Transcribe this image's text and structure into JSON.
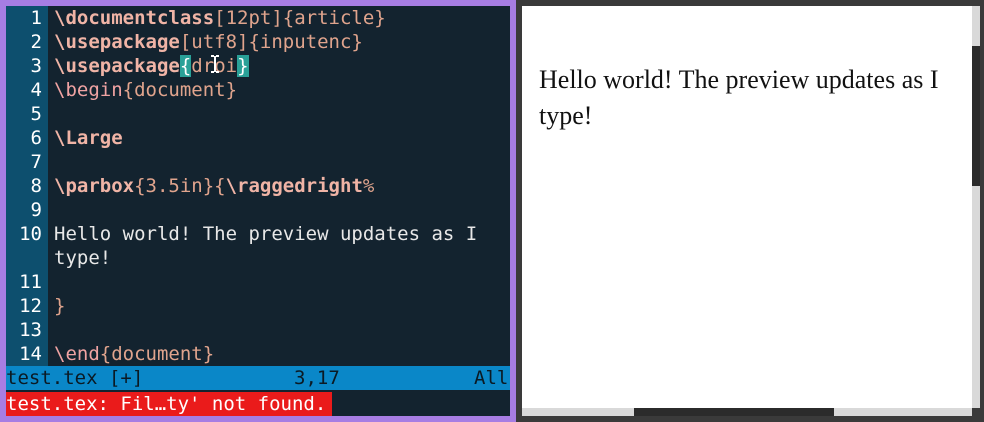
{
  "editor": {
    "lines": [
      {
        "num": "1",
        "parts": [
          {
            "cls": "kw",
            "text": "\\documentclass"
          },
          {
            "cls": "arg",
            "text": "[12pt]{article}"
          }
        ]
      },
      {
        "num": "2",
        "parts": [
          {
            "cls": "kw",
            "text": "\\usepackage"
          },
          {
            "cls": "arg",
            "text": "[utf8]{inputenc}"
          }
        ]
      },
      {
        "num": "3",
        "parts": [
          {
            "cls": "kw",
            "text": "\\usepackage"
          },
          {
            "cls": "hl",
            "text": "{"
          },
          {
            "cls": "arg",
            "text": "dr"
          },
          {
            "cls": "cursor",
            "text": ""
          },
          {
            "cls": "arg",
            "text": "oi"
          },
          {
            "cls": "hl",
            "text": "}"
          }
        ]
      },
      {
        "num": "4",
        "parts": [
          {
            "cls": "plain-kw",
            "text": "\\begin"
          },
          {
            "cls": "arg",
            "text": "{document}"
          }
        ]
      },
      {
        "num": "5",
        "parts": []
      },
      {
        "num": "6",
        "parts": [
          {
            "cls": "kw",
            "text": "\\Large"
          }
        ]
      },
      {
        "num": "7",
        "parts": []
      },
      {
        "num": "8",
        "parts": [
          {
            "cls": "kw",
            "text": "\\parbox"
          },
          {
            "cls": "arg",
            "text": "{3.5in}"
          },
          {
            "cls": "arg",
            "text": "{"
          },
          {
            "cls": "kw",
            "text": "\\raggedright"
          },
          {
            "cls": "arg",
            "text": "%"
          }
        ]
      },
      {
        "num": "9",
        "parts": []
      },
      {
        "num": "10",
        "parts": [
          {
            "cls": "",
            "text": "Hello world! The preview updates as I"
          }
        ]
      },
      {
        "num": "",
        "parts": [
          {
            "cls": "",
            "text": "type!"
          }
        ]
      },
      {
        "num": "11",
        "parts": []
      },
      {
        "num": "12",
        "parts": [
          {
            "cls": "arg",
            "text": "}"
          }
        ]
      },
      {
        "num": "13",
        "parts": []
      },
      {
        "num": "14",
        "parts": [
          {
            "cls": "plain-kw",
            "text": "\\end"
          },
          {
            "cls": "arg",
            "text": "{document}"
          }
        ]
      }
    ]
  },
  "status": {
    "filename": "test.tex [+]",
    "position": "3,17",
    "scroll": "All"
  },
  "message": "test.tex: Fil…ty' not found.",
  "preview": {
    "text": "Hello world! The preview updates as I type!"
  },
  "icons": {
    "cursor": "text-cursor-icon"
  },
  "colors": {
    "editor_bg": "#13232f",
    "gutter_bg": "#0d4f6e",
    "status_bg": "#0a87c8",
    "error_bg": "#ea1b1b",
    "frame_accent": "#a77de3"
  }
}
